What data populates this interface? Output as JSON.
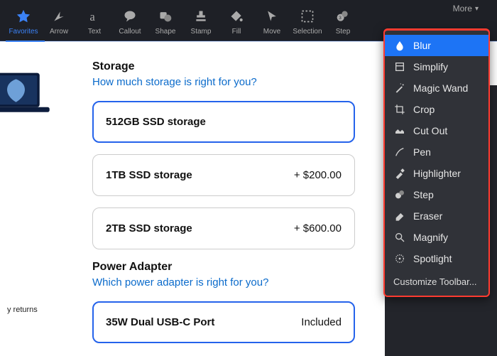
{
  "toolbar": {
    "items": [
      {
        "label": "Favorites",
        "icon": "star-icon",
        "selected": true
      },
      {
        "label": "Arrow",
        "icon": "cursor-arrow-icon"
      },
      {
        "label": "Text",
        "icon": "text-a-icon"
      },
      {
        "label": "Callout",
        "icon": "speech-bubble-icon"
      },
      {
        "label": "Shape",
        "icon": "shapes-icon"
      },
      {
        "label": "Stamp",
        "icon": "stamp-icon"
      },
      {
        "label": "Fill",
        "icon": "paint-bucket-icon"
      },
      {
        "label": "Move",
        "icon": "move-cursor-icon"
      },
      {
        "label": "Selection",
        "icon": "selection-icon"
      },
      {
        "label": "Step",
        "icon": "step-icon"
      }
    ],
    "more_label": "More"
  },
  "dropdown": {
    "items": [
      {
        "label": "Blur",
        "icon": "blur-icon",
        "highlight": true
      },
      {
        "label": "Simplify",
        "icon": "simplify-icon"
      },
      {
        "label": "Magic Wand",
        "icon": "magic-wand-icon"
      },
      {
        "label": "Crop",
        "icon": "crop-icon"
      },
      {
        "label": "Cut Out",
        "icon": "cut-out-icon"
      },
      {
        "label": "Pen",
        "icon": "pen-icon"
      },
      {
        "label": "Highlighter",
        "icon": "highlighter-icon"
      },
      {
        "label": "Step",
        "icon": "step-icon"
      },
      {
        "label": "Eraser",
        "icon": "eraser-icon"
      },
      {
        "label": "Magnify",
        "icon": "magnify-icon"
      },
      {
        "label": "Spotlight",
        "icon": "spotlight-icon"
      }
    ],
    "customize": "Customize Toolbar..."
  },
  "page": {
    "storage": {
      "title": "Storage",
      "help": "How much storage is right for you?",
      "options": [
        {
          "label": "512GB SSD storage",
          "price": "",
          "selected": true
        },
        {
          "label": "1TB SSD storage",
          "price": "+ $200.00"
        },
        {
          "label": "2TB SSD storage",
          "price": "+ $600.00"
        }
      ]
    },
    "power": {
      "title": "Power Adapter",
      "help": "Which power adapter is right for you?",
      "options": [
        {
          "label": "35W Dual USB-C Port",
          "price": "Included",
          "selected": true
        }
      ]
    },
    "returns_label": "y returns"
  }
}
